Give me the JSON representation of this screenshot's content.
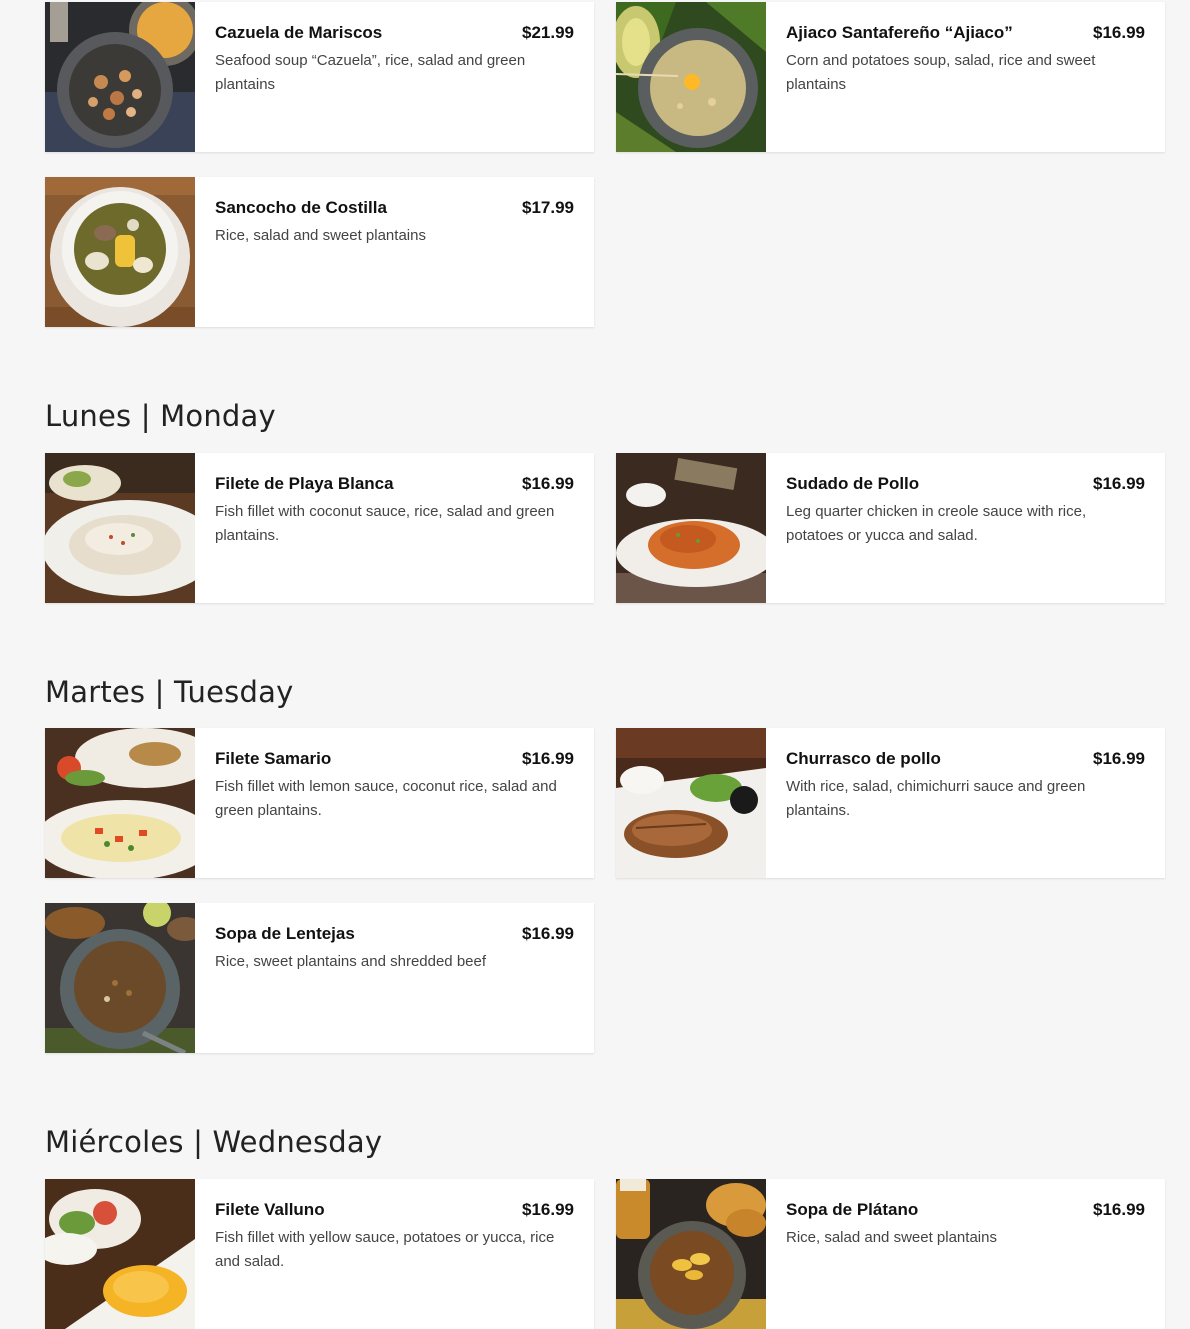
{
  "sections": {
    "soups_top": {
      "items": [
        {
          "name": "Cazuela de Mariscos",
          "price": "$21.99",
          "description": "Seafood soup “Cazuela”, rice, salad and green plantains",
          "image": "seafood-soup-photo"
        },
        {
          "name": "Ajiaco Santafereño “Ajiaco”",
          "price": "$16.99",
          "description": "Corn and potatoes soup, salad, rice and sweet plantains",
          "image": "ajiaco-soup-photo"
        },
        {
          "name": "Sancocho de Costilla",
          "price": "$17.99",
          "description": "Rice, salad and sweet plantains",
          "image": "sancocho-photo"
        }
      ]
    },
    "monday": {
      "heading": "Lunes | Monday",
      "items": [
        {
          "name": "Filete de Playa Blanca",
          "price": "$16.99",
          "description": "Fish fillet with coconut sauce, rice, salad and green plantains.",
          "image": "fish-coconut-photo"
        },
        {
          "name": "Sudado de Pollo",
          "price": "$16.99",
          "description": "Leg quarter chicken in creole sauce with rice, potatoes or yucca and salad.",
          "image": "chicken-creole-photo"
        }
      ]
    },
    "tuesday": {
      "heading": "Martes | Tuesday",
      "items": [
        {
          "name": "Filete Samario",
          "price": "$16.99",
          "description": "Fish fillet with lemon sauce, coconut rice, salad and green plantains.",
          "image": "fish-lemon-photo"
        },
        {
          "name": "Churrasco de pollo",
          "price": "$16.99",
          "description": "With rice, salad, chimichurri sauce and green plantains.",
          "image": "chicken-churrasco-photo"
        },
        {
          "name": "Sopa de Lentejas",
          "price": "$16.99",
          "description": "Rice, sweet plantains and shredded beef",
          "image": "lentil-soup-photo"
        }
      ]
    },
    "wednesday": {
      "heading": "Miércoles | Wednesday",
      "items": [
        {
          "name": "Filete Valluno",
          "price": "$16.99",
          "description": "Fish fillet with yellow sauce, potatoes or yucca, rice and salad.",
          "image": "fish-yellow-sauce-photo"
        },
        {
          "name": "Sopa de Plátano",
          "price": "$16.99",
          "description": "Rice, salad and sweet plantains",
          "image": "plantain-soup-photo"
        }
      ]
    }
  },
  "colors": {
    "page_background": "#f6f6f6",
    "card_background": "#ffffff",
    "text_primary": "#111111",
    "text_secondary": "#444444"
  }
}
